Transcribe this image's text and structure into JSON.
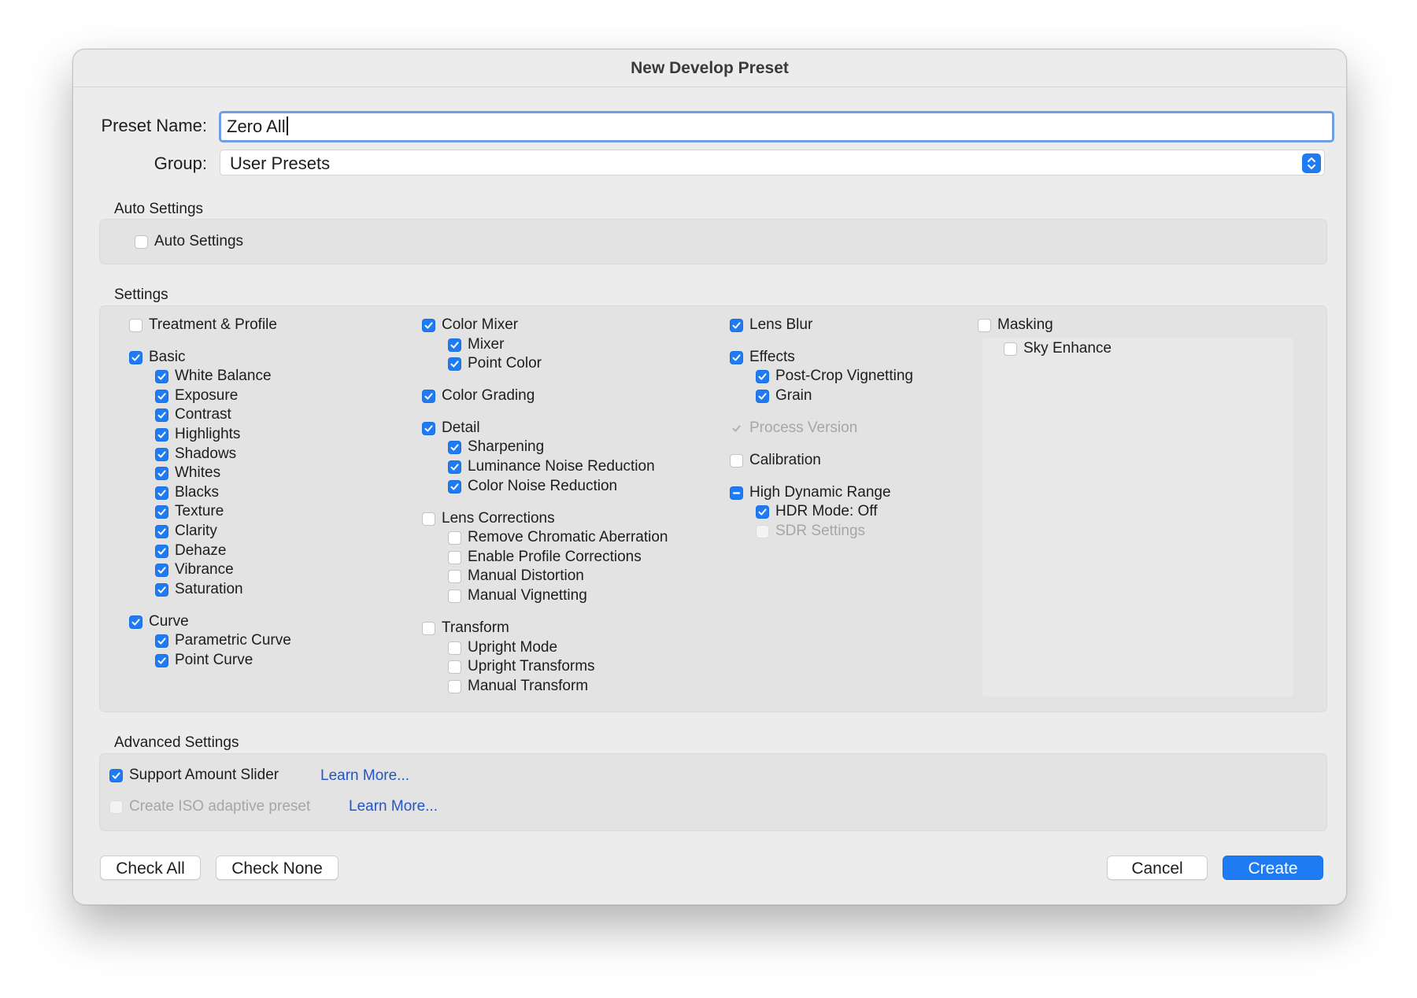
{
  "dialog": {
    "title": "New Develop Preset",
    "preset_name_label": "Preset Name:",
    "preset_name_value": "Zero All",
    "group_label": "Group:",
    "group_value": "User Presets"
  },
  "auto_settings": {
    "section_title": "Auto Settings",
    "checkbox": {
      "label": "Auto Settings",
      "state": "off"
    }
  },
  "settings": {
    "section_title": "Settings",
    "items": [
      {
        "label": "Treatment & Profile",
        "state": "off"
      },
      {
        "label": "Basic",
        "state": "on"
      },
      {
        "label": "White Balance",
        "state": "on"
      },
      {
        "label": "Exposure",
        "state": "on"
      },
      {
        "label": "Contrast",
        "state": "on"
      },
      {
        "label": "Highlights",
        "state": "on"
      },
      {
        "label": "Shadows",
        "state": "on"
      },
      {
        "label": "Whites",
        "state": "on"
      },
      {
        "label": "Blacks",
        "state": "on"
      },
      {
        "label": "Texture",
        "state": "on"
      },
      {
        "label": "Clarity",
        "state": "on"
      },
      {
        "label": "Dehaze",
        "state": "on"
      },
      {
        "label": "Vibrance",
        "state": "on"
      },
      {
        "label": "Saturation",
        "state": "on"
      },
      {
        "label": "Curve",
        "state": "on"
      },
      {
        "label": "Parametric Curve",
        "state": "on"
      },
      {
        "label": "Point Curve",
        "state": "on"
      },
      {
        "label": "Color Mixer",
        "state": "on"
      },
      {
        "label": "Mixer",
        "state": "on"
      },
      {
        "label": "Point Color",
        "state": "on"
      },
      {
        "label": "Color Grading",
        "state": "on"
      },
      {
        "label": "Detail",
        "state": "on"
      },
      {
        "label": "Sharpening",
        "state": "on"
      },
      {
        "label": "Luminance Noise Reduction",
        "state": "on"
      },
      {
        "label": "Color Noise Reduction",
        "state": "on"
      },
      {
        "label": "Lens Corrections",
        "state": "off"
      },
      {
        "label": "Remove Chromatic Aberration",
        "state": "off"
      },
      {
        "label": "Enable Profile Corrections",
        "state": "off"
      },
      {
        "label": "Manual Distortion",
        "state": "off"
      },
      {
        "label": "Manual Vignetting",
        "state": "off"
      },
      {
        "label": "Transform",
        "state": "off"
      },
      {
        "label": "Upright Mode",
        "state": "off"
      },
      {
        "label": "Upright Transforms",
        "state": "off"
      },
      {
        "label": "Manual Transform",
        "state": "off"
      },
      {
        "label": "Lens Blur",
        "state": "on"
      },
      {
        "label": "Effects",
        "state": "on"
      },
      {
        "label": "Post-Crop Vignetting",
        "state": "on"
      },
      {
        "label": "Grain",
        "state": "on"
      },
      {
        "label": "Process Version",
        "state": "disabled-on"
      },
      {
        "label": "Calibration",
        "state": "off"
      },
      {
        "label": "High Dynamic Range",
        "state": "mixed"
      },
      {
        "label": "HDR Mode: Off",
        "state": "on"
      },
      {
        "label": "SDR Settings",
        "state": "disabled-off"
      },
      {
        "label": "Masking",
        "state": "off"
      },
      {
        "label": "Sky Enhance",
        "state": "off"
      }
    ]
  },
  "advanced_settings": {
    "section_title": "Advanced Settings",
    "support_amount_slider": {
      "label": "Support Amount Slider",
      "state": "on"
    },
    "iso_adaptive": {
      "label": "Create ISO adaptive preset",
      "state": "disabled-off"
    },
    "learn_more_1": "Learn More...",
    "learn_more_2": "Learn More..."
  },
  "footer": {
    "check_all": "Check All",
    "check_none": "Check None",
    "cancel": "Cancel",
    "create": "Create"
  },
  "colors": {
    "accent": "#1e7bf3",
    "link": "#2455c4",
    "dialog_bg": "#ececec",
    "panel_bg": "#e3e3e3"
  }
}
